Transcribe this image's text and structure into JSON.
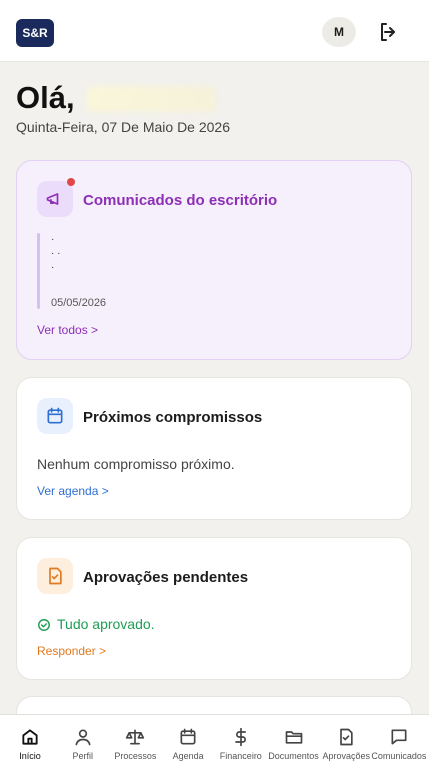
{
  "header": {
    "logo": "S&R",
    "avatar_initial": "M"
  },
  "greeting": {
    "title": "Olá,",
    "date": "Quinta-Feira, 07 De Maio De 2026"
  },
  "cards": {
    "comunicados": {
      "title": "Comunicados do escritório",
      "message_date": "05/05/2026",
      "link": "Ver todos >"
    },
    "compromissos": {
      "title": "Próximos compromissos",
      "status": "Nenhum compromisso próximo.",
      "link": "Ver agenda >"
    },
    "aprovacoes": {
      "title": "Aprovações pendentes",
      "status": "Tudo aprovado.",
      "link": "Responder >"
    }
  },
  "tabs": [
    {
      "label": "Início",
      "icon": "home-icon"
    },
    {
      "label": "Perfil",
      "icon": "user-icon"
    },
    {
      "label": "Processos",
      "icon": "scale-icon"
    },
    {
      "label": "Agenda",
      "icon": "calendar-icon"
    },
    {
      "label": "Financeiro",
      "icon": "dollar-icon"
    },
    {
      "label": "Documentos",
      "icon": "folder-icon"
    },
    {
      "label": "Aprovações",
      "icon": "file-check-icon"
    },
    {
      "label": "Comunicados",
      "icon": "message-icon"
    }
  ],
  "colors": {
    "brand": "#1b2a5c",
    "comunicados_accent": "#8d2fb5",
    "agenda_accent": "#2f6fd1",
    "aprovacoes_accent": "#e07a20",
    "success": "#1f9d55"
  }
}
